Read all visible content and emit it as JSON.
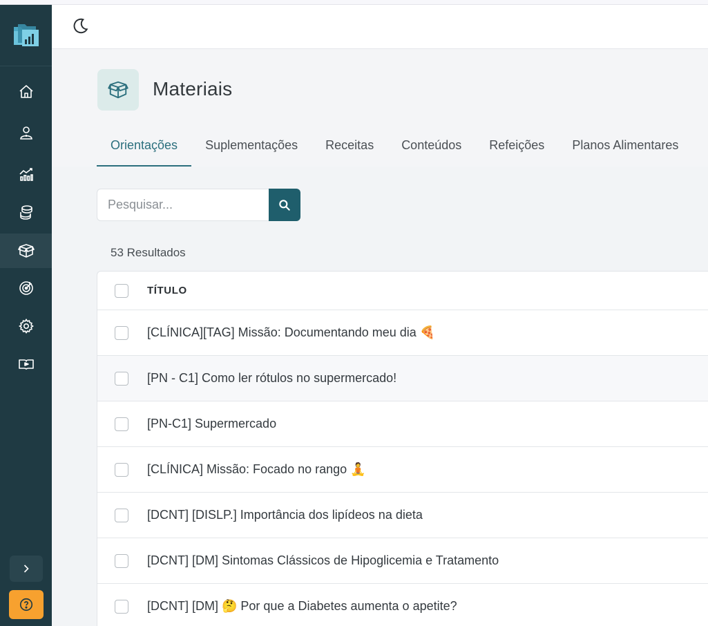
{
  "sidebar": {
    "nav_items": [
      {
        "name": "home",
        "icon": "home-icon"
      },
      {
        "name": "patients",
        "icon": "user-icon"
      },
      {
        "name": "analytics",
        "icon": "chart-icon"
      },
      {
        "name": "finance",
        "icon": "coins-icon"
      },
      {
        "name": "materials",
        "icon": "box-icon",
        "active": true
      },
      {
        "name": "goals",
        "icon": "target-icon"
      },
      {
        "name": "settings",
        "icon": "gear-icon"
      },
      {
        "name": "tutorials",
        "icon": "video-book-icon"
      }
    ],
    "accent_color": "#f7a12f",
    "background_color": "#1f3a43"
  },
  "header": {
    "title": "Materiais",
    "tabs": [
      {
        "label": "Orientações",
        "active": true
      },
      {
        "label": "Suplementações"
      },
      {
        "label": "Receitas"
      },
      {
        "label": "Conteúdos"
      },
      {
        "label": "Refeições"
      },
      {
        "label": "Planos Alimentares"
      }
    ]
  },
  "search": {
    "placeholder": "Pesquisar...",
    "value": ""
  },
  "results_label": "53 Resultados",
  "table": {
    "column_header": "TÍTULO",
    "rows": [
      "[CLÍNICA][TAG] Missão: Documentando meu dia 🍕",
      "[PN - C1] Como ler rótulos no supermercado!",
      "[PN-C1] Supermercado",
      "[CLÍNICA] Missão: Focado no rango 🧘",
      "[DCNT] [DISLP.] Importância dos lipídeos na dieta",
      "[DCNT] [DM] Sintomas Clássicos de Hipoglicemia e Tratamento",
      "[DCNT] [DM] 🤔 Por que a Diabetes aumenta o apetite?"
    ]
  }
}
